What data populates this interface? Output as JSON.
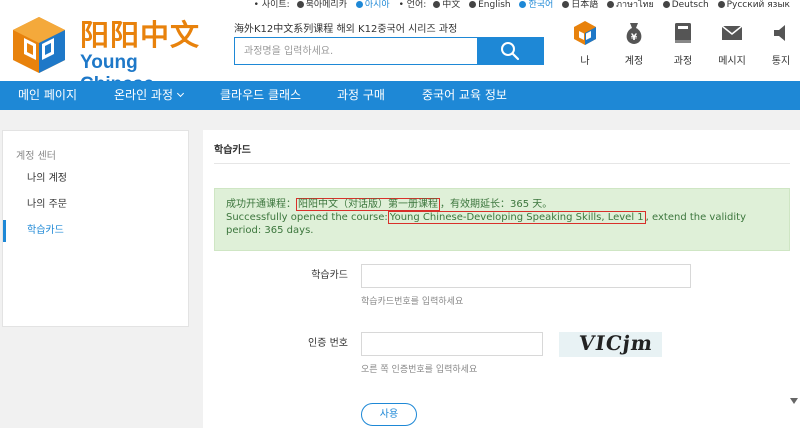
{
  "topbar": {
    "site_label": "• 사이트:",
    "sites": [
      "북아메리카",
      "아시아"
    ],
    "active_site": 1,
    "lang_label": "• 언어:",
    "languages": [
      "中文",
      "English",
      "한국어",
      "日本語",
      "ภาษาไทย",
      "Deutsch",
      "Русский язык"
    ],
    "active_language": 2
  },
  "header": {
    "logo_cn": "阳阳中文",
    "logo_en": "Young Chinese",
    "slogan": "海外K12中文系列课程 해외 K12중국어 시리즈 과정",
    "search_placeholder": "과정명을 입력하세요.",
    "icons": [
      {
        "label": "나",
        "icon": "user-logo-icon"
      },
      {
        "label": "계정",
        "icon": "money-bag-icon"
      },
      {
        "label": "과정",
        "icon": "book-icon"
      },
      {
        "label": "메시지",
        "icon": "envelope-icon"
      },
      {
        "label": "통지",
        "icon": "speaker-icon"
      }
    ]
  },
  "nav": {
    "items": [
      "메인 페이지",
      "온라인 과정",
      "클라우드 클래스",
      "과정 구매",
      "중국어 교육 정보"
    ]
  },
  "sidebar": {
    "heading": "계정 센터",
    "items": [
      "나의 계정",
      "나의 주문",
      "학습카드"
    ],
    "active": 2
  },
  "main": {
    "title": "학습카드",
    "alert": {
      "cn_prefix": "成功开通课程：",
      "cn_course": "阳阳中文（对话版）第一册课程",
      "cn_suffix": "，有效期延长：365 天。",
      "en_prefix": "Successfully opened the course:",
      "en_course": "Young Chinese-Developing Speaking Skills, Level 1",
      "en_suffix": ", extend the validity period: 365 days."
    },
    "card_label": "학습카드",
    "card_value": "",
    "card_hint": "학습카드번호를 입력하세요",
    "code_label": "인증 번호",
    "code_value": "",
    "code_hint": "오른 쪽 인증번호를 입력하세요",
    "captcha_text": "VICjm",
    "submit_label": "사용"
  },
  "colors": {
    "accent": "#1e88d6",
    "logo_orange": "#e8820c",
    "success_bg": "#dff0d8",
    "success_text": "#3c763d",
    "highlight_border": "#d9302a"
  }
}
